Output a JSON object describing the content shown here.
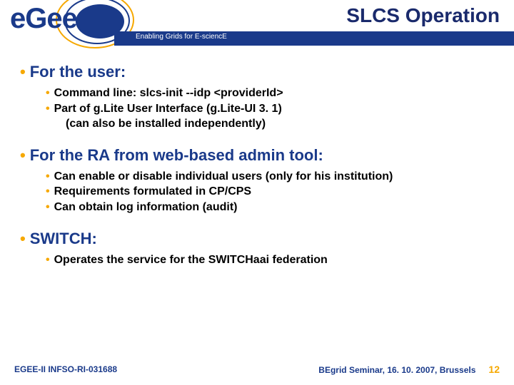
{
  "header": {
    "title": "SLCS Operation",
    "tagline": "Enabling Grids for E-sciencE",
    "logo_text": "eGee"
  },
  "sections": [
    {
      "heading": "For the user:",
      "items": [
        "Command line: slcs-init --idp <providerId>",
        "Part of g.Lite User Interface (g.Lite-UI 3. 1)",
        "(can also be installed independently)"
      ],
      "indent_last": true
    },
    {
      "heading": "For the RA from web-based admin tool:",
      "items": [
        "Can enable or disable individual users (only for his institution)",
        "Requirements formulated in CP/CPS",
        "Can obtain log information (audit)"
      ],
      "indent_last": false
    },
    {
      "heading": "SWITCH:",
      "items": [
        "Operates the service for the SWITCHaai federation"
      ],
      "indent_last": false
    }
  ],
  "footer": {
    "left": "EGEE-II INFSO-RI-031688",
    "right": "BEgrid Seminar, 16. 10. 2007, Brussels",
    "slide_number": "12"
  }
}
